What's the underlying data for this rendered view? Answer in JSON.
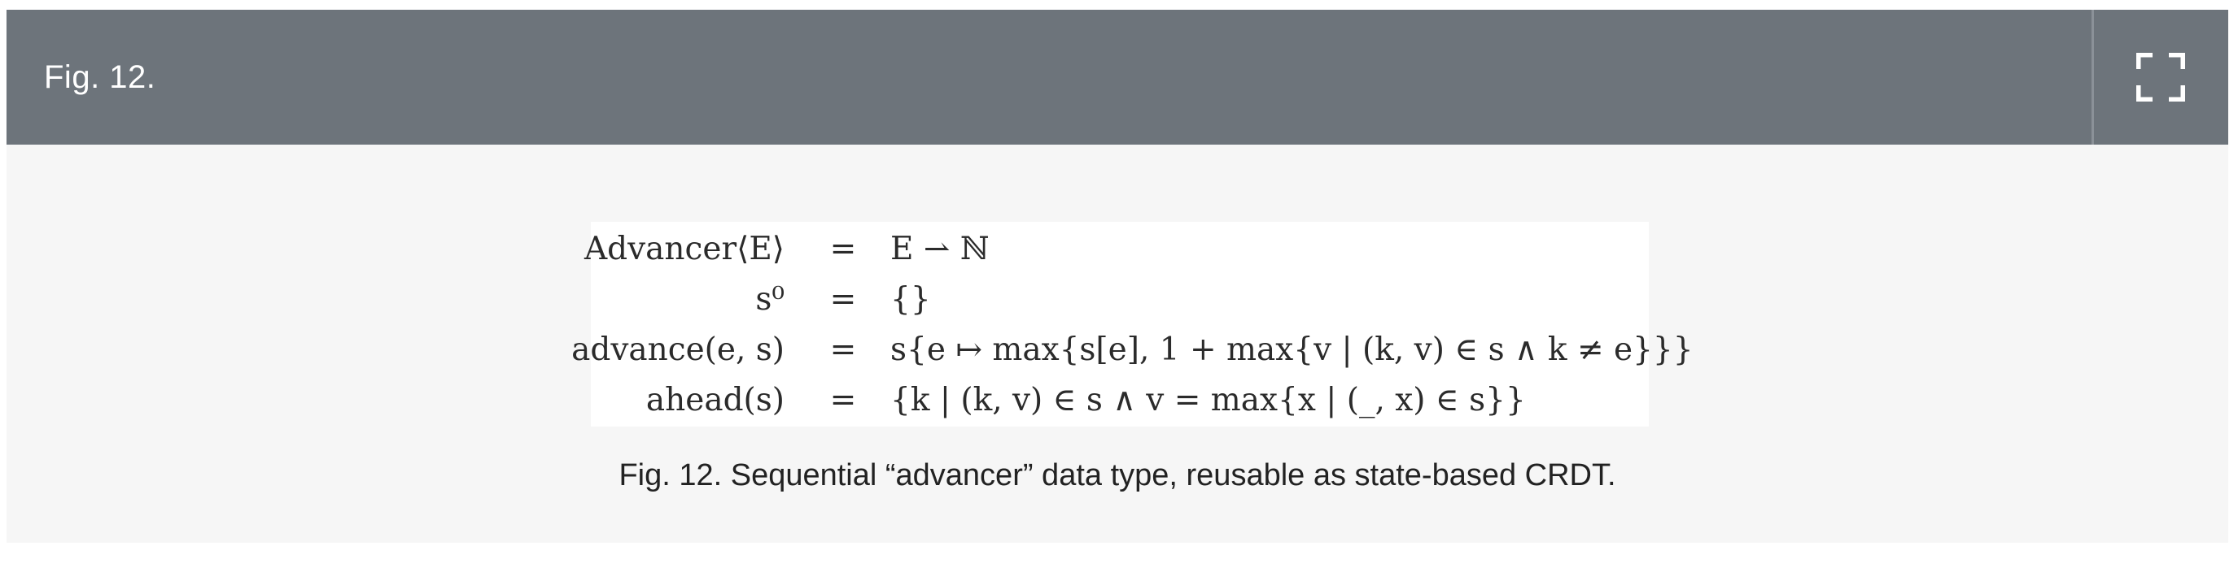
{
  "header": {
    "figure_label": "Fig. 12.",
    "expand_icon": "expand-fullscreen-icon",
    "header_color": "#6d747b"
  },
  "figure": {
    "equations": [
      {
        "lhs": "Advancer⟨E⟩",
        "sign": "=",
        "rhs": "E ⇀ ℕ"
      },
      {
        "lhs": "s⁰",
        "sign": "=",
        "rhs": "{}"
      },
      {
        "lhs": "advance(e, s)",
        "sign": "=",
        "rhs": "s{e ↦ max{s[e], 1 + max{v | (k, v) ∈ s ∧ k ≠ e}}}"
      },
      {
        "lhs": "ahead(s)",
        "sign": "=",
        "rhs": "{k | (k, v) ∈ s ∧ v = max{x | (_, x) ∈ s}}"
      }
    ],
    "caption": "Fig. 12. Sequential “advancer” data type, reusable as state-based CRDT."
  }
}
